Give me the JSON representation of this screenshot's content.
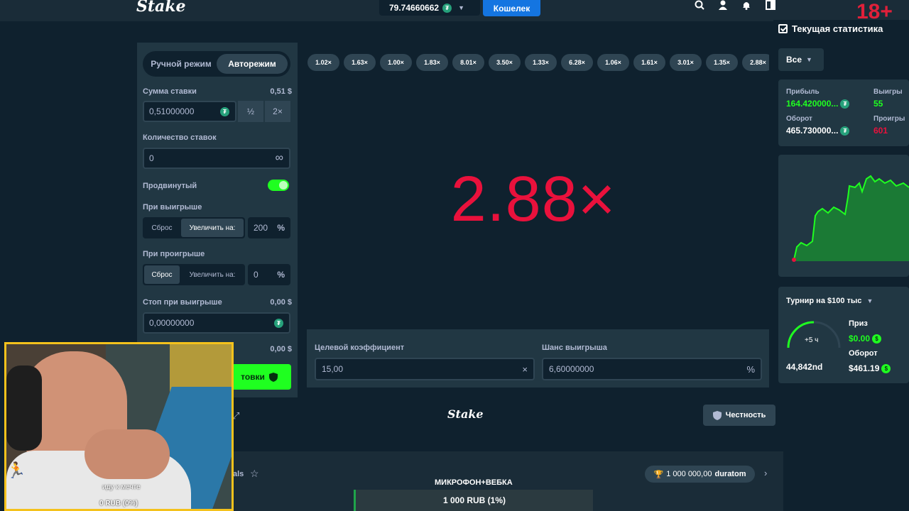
{
  "header": {
    "logo": "Stake",
    "balance": "79.74660662",
    "wallet_label": "Кошелек",
    "age_badge": "18+",
    "icons": [
      "search-icon",
      "user-icon",
      "bell-icon",
      "sidebar-icon"
    ]
  },
  "controls": {
    "mode_manual": "Ручной режим",
    "mode_auto": "Авторежим",
    "bet_amount_label": "Сумма ставки",
    "bet_amount_usd": "0,51 $",
    "bet_amount_value": "0,51000000",
    "half_label": "½",
    "double_label": "2×",
    "num_bets_label": "Количество ставок",
    "num_bets_value": "0",
    "infinity": "∞",
    "advanced_label": "Продвинутый",
    "on_win_label": "При выигрыше",
    "on_win_reset": "Сброс",
    "on_win_increase": "Увеличить на:",
    "on_win_value": "200",
    "on_loss_label": "При проигрыше",
    "on_loss_reset": "Сброс",
    "on_loss_increase": "Увеличить на:",
    "on_loss_value": "0",
    "percent": "%",
    "stop_win_label": "Стоп при выигрыше",
    "stop_win_usd": "0,00 $",
    "stop_win_value": "0,00000000",
    "stop_loss_usd": "0,00 $",
    "bet_button": "товки"
  },
  "game": {
    "history": [
      "1.02×",
      "1.63×",
      "1.00×",
      "1.83×",
      "8.01×",
      "3.50×",
      "1.33×",
      "6.28×",
      "1.06×",
      "1.61×",
      "3.01×",
      "1.35×",
      "2.88×"
    ],
    "multiplier": "2.88×",
    "target_label": "Целевой коэффициент",
    "target_value": "15,00",
    "target_suffix": "×",
    "chance_label": "Шанс выигрыша",
    "chance_value": "6,60000000",
    "chance_suffix": "%"
  },
  "footer": {
    "logo": "Stake",
    "fairness": "Честность",
    "partial_label": "als",
    "prize": "1 000 000,00",
    "prize_user": "duratom",
    "mic_label": "МИКРОФОН+ВЕБКА",
    "goal": "1 000 RUB (1%)"
  },
  "stats": {
    "title": "Текущая статистика",
    "filter": "Все",
    "profit_label": "Прибыль",
    "profit_value": "164.420000...",
    "wins_label": "Выигры",
    "wins_value": "55",
    "wager_label": "Оборот",
    "wager_value": "465.730000...",
    "losses_label": "Проигры",
    "losses_value": "601",
    "tournament_title": "Турнир на $100 тыс",
    "timer": "+5 ч",
    "rank": "44,842nd",
    "prize_label": "Приз",
    "prize_value": "$0.00",
    "turnover_label": "Оборот",
    "turnover_value": "$461.19"
  },
  "webcam": {
    "caption": "иду к мечте",
    "donation": "0 RUB (0%)"
  },
  "colors": {
    "accent_blue": "#1475e1",
    "multiplier_red": "#e9113c",
    "green": "#1fff20",
    "profit_green": "#1fff20",
    "loss_red": "#e9113c"
  }
}
